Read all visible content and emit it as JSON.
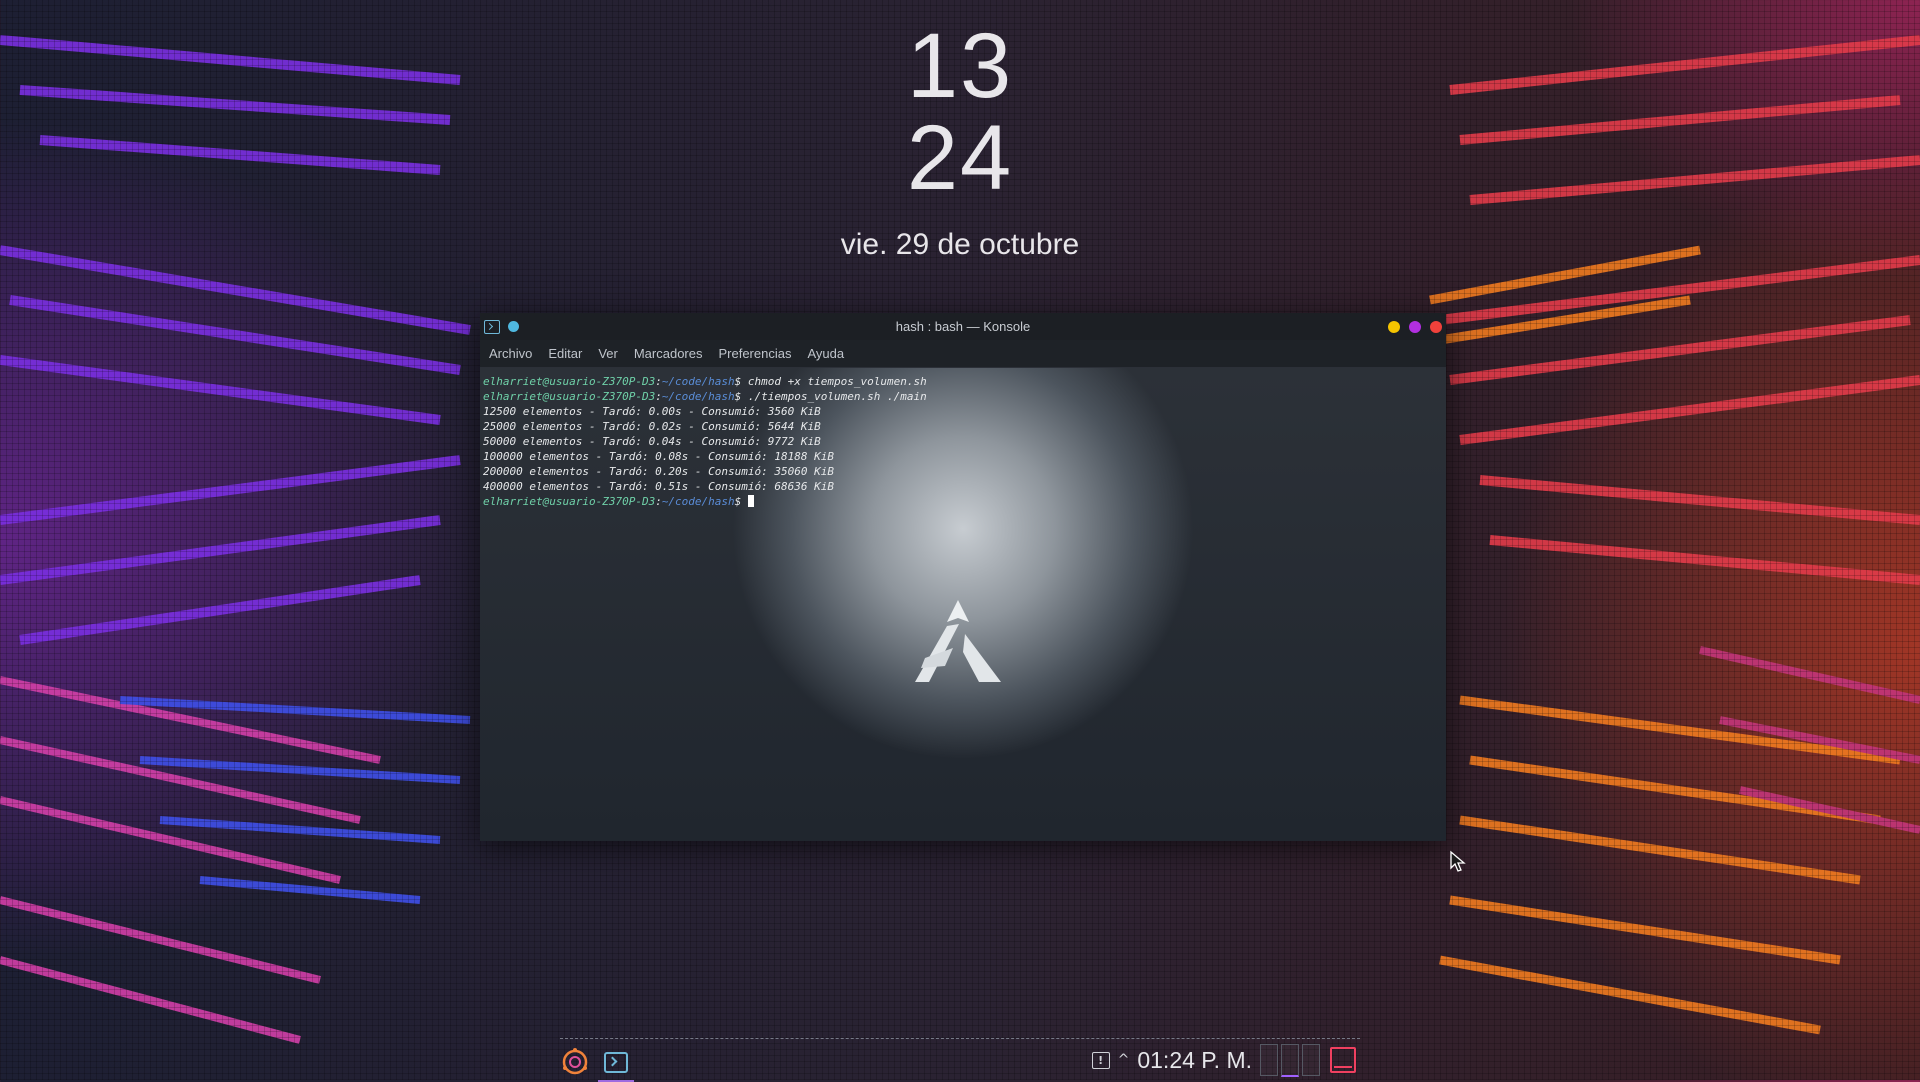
{
  "lockclock": {
    "hour": "13",
    "minute": "24",
    "date": "vie. 29 de octubre"
  },
  "window": {
    "title": "hash : bash — Konsole",
    "menu": [
      "Archivo",
      "Editar",
      "Ver",
      "Marcadores",
      "Preferencias",
      "Ayuda"
    ]
  },
  "terminal": {
    "prompt_user": "elharriet@usuario-Z370P-D3",
    "prompt_path": "~/code/hash",
    "commands": [
      "chmod +x tiempos_volumen.sh",
      "./tiempos_volumen.sh ./main"
    ],
    "output": [
      "12500 elementos - Tardó: 0.00s - Consumió: 3560 KiB",
      "25000 elementos - Tardó: 0.02s - Consumió: 5644 KiB",
      "50000 elementos - Tardó: 0.04s - Consumió: 9772 KiB",
      "100000 elementos - Tardó: 0.08s - Consumió: 18188 KiB",
      "200000 elementos - Tardó: 0.20s - Consumió: 35060 KiB",
      "400000 elementos - Tardó: 0.51s - Consumió: 68636 KiB"
    ]
  },
  "taskbar": {
    "clock": "01:24 P. M."
  },
  "colors": {
    "accent_purple": "#9f6be0",
    "minimize": "#f5c400",
    "maximize": "#b12fe0",
    "close": "#f0413b",
    "prompt_user": "#6fd0a8",
    "prompt_path": "#5a8cd6"
  },
  "icons": [
    "konsole-icon",
    "pin-icon",
    "assassins-logo-icon",
    "launcher-icon",
    "notification-icon",
    "expand-arrow-icon",
    "show-desktop-icon",
    "mouse-cursor-icon"
  ]
}
